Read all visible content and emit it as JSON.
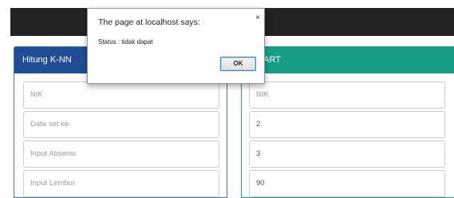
{
  "panels": {
    "knn": {
      "title": "Hitung K-NN",
      "fields": [
        {
          "value": "",
          "placeholder": "NIK"
        },
        {
          "value": "",
          "placeholder": "Data set ke-"
        },
        {
          "value": "",
          "placeholder": "Input Absensi"
        },
        {
          "value": "",
          "placeholder": "Input Lembur"
        }
      ]
    },
    "cart": {
      "title": "g CART",
      "fields": [
        {
          "value": "",
          "placeholder": "NIK"
        },
        {
          "value": "2",
          "placeholder": ""
        },
        {
          "value": "3",
          "placeholder": ""
        },
        {
          "value": "90",
          "placeholder": ""
        }
      ]
    }
  },
  "dialog": {
    "title": "The page at localhost says:",
    "close_glyph": "×",
    "message": "Status : tidak dapat",
    "ok_label": "OK"
  },
  "colors": {
    "navbar": "#222222",
    "knn_heading": "#1f4e96",
    "cart_heading": "#189e86"
  }
}
